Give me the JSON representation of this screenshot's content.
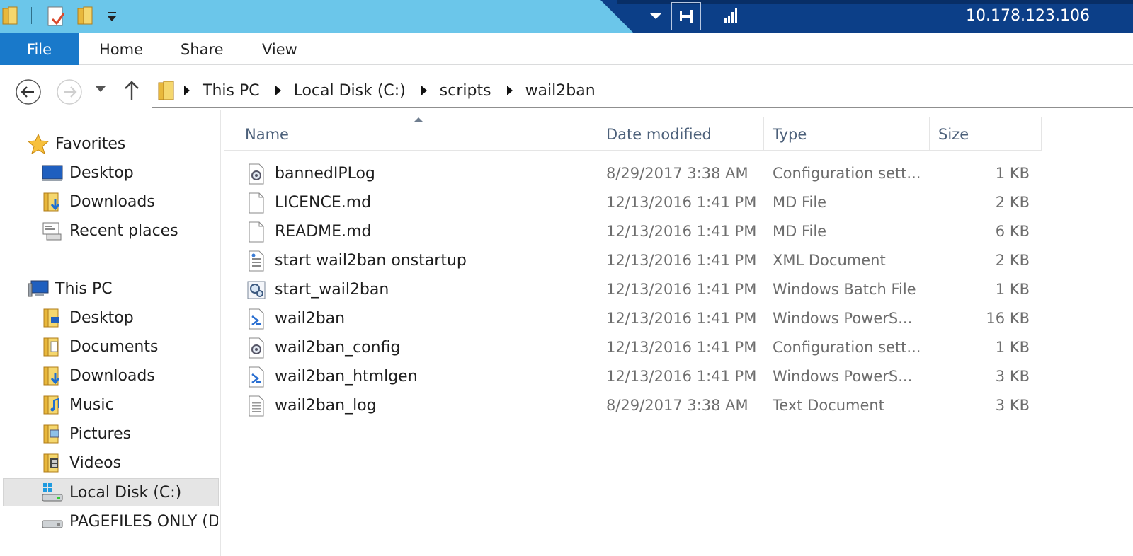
{
  "remote": {
    "ip": "10.178.123.106"
  },
  "ribbon": {
    "tabs": [
      {
        "label": "File"
      },
      {
        "label": "Home"
      },
      {
        "label": "Share"
      },
      {
        "label": "View"
      }
    ]
  },
  "address": {
    "crumbs": [
      "This PC",
      "Local Disk (C:)",
      "scripts",
      "wail2ban"
    ]
  },
  "nav": {
    "favorites_label": "Favorites",
    "favorites": [
      "Desktop",
      "Downloads",
      "Recent places"
    ],
    "thispc_label": "This PC",
    "thispc": [
      "Desktop",
      "Documents",
      "Downloads",
      "Music",
      "Pictures",
      "Videos",
      "Local Disk (C:)",
      "PAGEFILES ONLY (D:"
    ]
  },
  "columns": {
    "name": "Name",
    "date": "Date modified",
    "type": "Type",
    "size": "Size"
  },
  "files": [
    {
      "name": "bannedIPLog",
      "date": "8/29/2017 3:38 AM",
      "type": "Configuration sett...",
      "size": "1 KB",
      "icon": "config-file-icon"
    },
    {
      "name": "LICENCE.md",
      "date": "12/13/2016 1:41 PM",
      "type": "MD File",
      "size": "2 KB",
      "icon": "blank-file-icon"
    },
    {
      "name": "README.md",
      "date": "12/13/2016 1:41 PM",
      "type": "MD File",
      "size": "6 KB",
      "icon": "blank-file-icon"
    },
    {
      "name": "start wail2ban onstartup",
      "date": "12/13/2016 1:41 PM",
      "type": "XML Document",
      "size": "2 KB",
      "icon": "xml-file-icon"
    },
    {
      "name": "start_wail2ban",
      "date": "12/13/2016 1:41 PM",
      "type": "Windows Batch File",
      "size": "1 KB",
      "icon": "batch-file-icon"
    },
    {
      "name": "wail2ban",
      "date": "12/13/2016 1:41 PM",
      "type": "Windows PowerS...",
      "size": "16 KB",
      "icon": "powershell-file-icon"
    },
    {
      "name": "wail2ban_config",
      "date": "12/13/2016 1:41 PM",
      "type": "Configuration sett...",
      "size": "1 KB",
      "icon": "config-file-icon"
    },
    {
      "name": "wail2ban_htmlgen",
      "date": "12/13/2016 1:41 PM",
      "type": "Windows PowerS...",
      "size": "3 KB",
      "icon": "powershell-file-icon"
    },
    {
      "name": "wail2ban_log",
      "date": "8/29/2017 3:38 AM",
      "type": "Text Document",
      "size": "3 KB",
      "icon": "text-file-icon"
    }
  ]
}
